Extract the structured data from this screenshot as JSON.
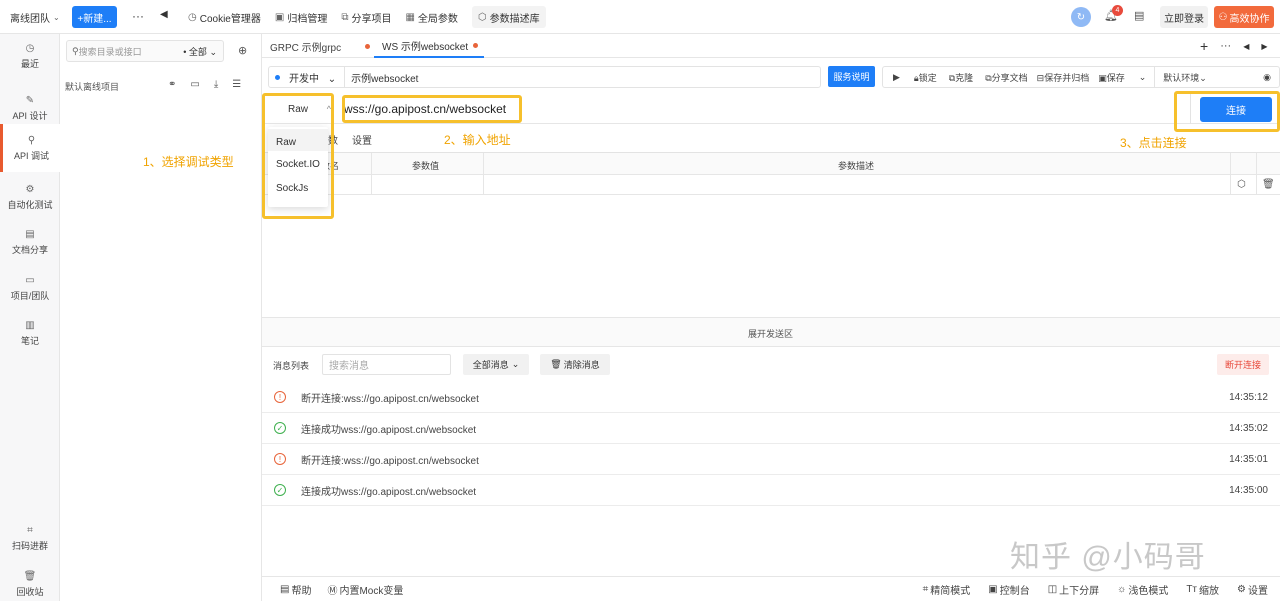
{
  "topbar": {
    "team": "离线团队",
    "new_button": "+新建...",
    "more": "···",
    "nav_items": [
      {
        "icon": "clock-icon",
        "label": "Cookie管理器"
      },
      {
        "icon": "archive-icon",
        "label": "归档管理"
      },
      {
        "icon": "share-icon",
        "label": "分享项目"
      },
      {
        "icon": "grid-icon",
        "label": "全局参数"
      },
      {
        "icon": "cube-icon",
        "label": "参数描述库"
      }
    ],
    "notification_count": "4",
    "login": "立即登录",
    "collab": "高效协作"
  },
  "sidebar": {
    "items": [
      {
        "icon": "history-icon",
        "label": "最近"
      },
      {
        "icon": "api-design-icon",
        "label": "API 设计"
      },
      {
        "icon": "api-debug-icon",
        "label": "API 调试"
      },
      {
        "icon": "auto-test-icon",
        "label": "自动化测试"
      },
      {
        "icon": "doc-share-icon",
        "label": "文档分享"
      },
      {
        "icon": "project-icon",
        "label": "项目/团队"
      },
      {
        "icon": "note-icon",
        "label": "笔记"
      }
    ],
    "scan": "扫码进群",
    "recycle": "回收站"
  },
  "tree": {
    "search_placeholder": "搜索目录或接口",
    "filter": "全部",
    "project": "默认离线项目"
  },
  "tabs": [
    {
      "label": "GRPC 示例grpc"
    },
    {
      "label": "WS 示例websocket"
    }
  ],
  "request": {
    "status": "开发中",
    "name": "示例websocket",
    "service_doc": "服务说明",
    "actions": [
      "锁定",
      "克隆",
      "分享文档",
      "保存并归档",
      "保存"
    ],
    "env": "默认环境",
    "protocol": "Raw",
    "url": "wss://go.apipost.cn/websocket",
    "connect": "连接",
    "protocol_options": [
      "Raw",
      "Socket.IO",
      "SockJs"
    ],
    "subtabs": [
      "参数",
      "设置"
    ],
    "table_headers": [
      "参数名",
      "参数值",
      "参数描述"
    ]
  },
  "annotations": {
    "step1": "1、选择调试类型",
    "step2": "2、输入地址",
    "step3": "3、点击连接"
  },
  "messages": {
    "expand": "展开发送区",
    "list_label": "消息列表",
    "search_placeholder": "搜索消息",
    "filter": "全部消息",
    "clear": "清除消息",
    "disconnect": "断开连接",
    "items": [
      {
        "type": "disconnect",
        "text": "断开连接:wss://go.apipost.cn/websocket",
        "time": "14:35:12"
      },
      {
        "type": "connect",
        "text": "连接成功wss://go.apipost.cn/websocket",
        "time": "14:35:02"
      },
      {
        "type": "disconnect",
        "text": "断开连接:wss://go.apipost.cn/websocket",
        "time": "14:35:01"
      },
      {
        "type": "connect",
        "text": "连接成功wss://go.apipost.cn/websocket",
        "time": "14:35:00"
      }
    ]
  },
  "bottombar": {
    "help": "帮助",
    "mock": "内置Mock变量",
    "simple": "精简模式",
    "console": "控制台",
    "split": "上下分屏",
    "theme": "浅色模式",
    "zoom": "缩放",
    "settings": "设置"
  },
  "watermark": "知乎 @小码哥"
}
